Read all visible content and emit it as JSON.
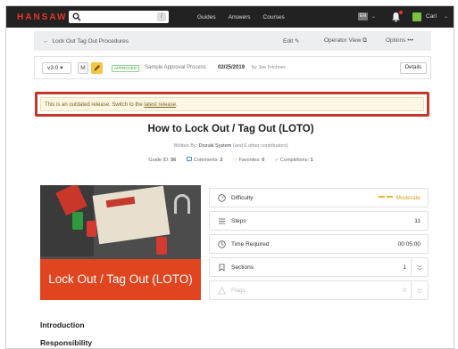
{
  "nav": {
    "logo": "HANSAW",
    "search_shortcut": "/",
    "links": [
      "Guides",
      "Answers",
      "Courses"
    ],
    "language": "EN",
    "user": "Carl"
  },
  "breadcrumb": {
    "back_label": "Lock Out Tag Out Procedures",
    "edit": "Edit",
    "operator_view": "Operator View",
    "options": "Options"
  },
  "version_bar": {
    "version": "v3.0",
    "m_label": "M",
    "status": "APPROVED",
    "process": "Sample Approval Process",
    "date": "02/25/2019",
    "by": "by Joe Frichner",
    "details": "Details"
  },
  "notice": {
    "text": "This is an outdated release. Switch to the ",
    "link": "latest release",
    "end": "."
  },
  "guide": {
    "title": "How to Lock Out / Tag Out (LOTO)",
    "written_by_prefix": "Written By: ",
    "author": "Dozuki System",
    "contributors": " (and 6 other contributors)",
    "guide_id_label": "Guide ID:",
    "guide_id": "56",
    "comments_label": "Comments:",
    "comments": "2",
    "favorites_label": "Favorites:",
    "favorites": "0",
    "completions_label": "Completions:",
    "completions": "1",
    "image_caption": "Lock Out / Tag Out (LOTO)"
  },
  "stats": {
    "difficulty_label": "Difficulty",
    "difficulty": "Moderate",
    "steps_label": "Steps",
    "steps": "11",
    "time_label": "Time Required",
    "time": "00:05:00",
    "sections_label": "Sections",
    "sections": "1",
    "flags_label": "Flags",
    "flags": "0"
  },
  "headings": {
    "introduction": "Introduction",
    "responsibility": "Responsibility"
  },
  "colors": {
    "accent_red": "#c0392b",
    "difficulty": "#e0a11a",
    "hero_caption_bg": "#e0451f"
  }
}
